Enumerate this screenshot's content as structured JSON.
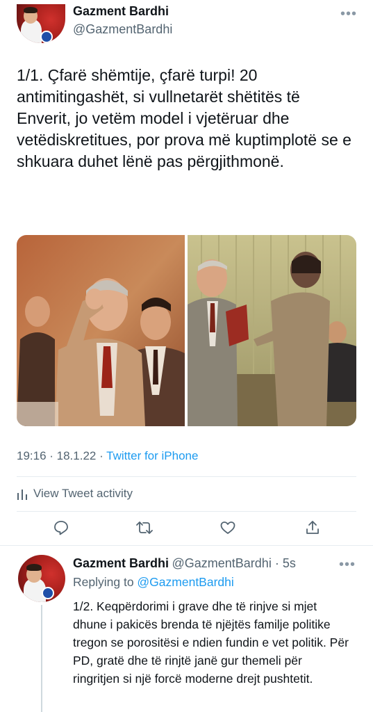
{
  "main_tweet": {
    "author_name": "Gazment Bardhi",
    "author_handle": "@GazmentBardhi",
    "more_icon": "more-horizontal-icon",
    "text": "1/1. Çfarë shëmtije, çfarë turpi! 20 antimitingashët, si vullnetarët shëtitës të Enverit, jo vetëm model i vjetëruar dhe vetëdiskretitues, por prova më kuptimplotë se e shkuara duhet lënë pas përgjithmonë.",
    "photos": [
      "photo-left",
      "photo-right"
    ],
    "time": "19:16 · 18.1.22 · ",
    "source": "Twitter for iPhone",
    "activity_label": "View Tweet activity",
    "activity_icon": "bar-chart-icon",
    "actions": [
      "reply-icon",
      "retweet-icon",
      "like-icon",
      "share-icon"
    ]
  },
  "reply_tweet": {
    "author_name": "Gazment Bardhi",
    "author_handle": "@GazmentBardhi · 5s",
    "replying_prefix": "Replying to ",
    "replying_handle": "@GazmentBardhi",
    "text": "1/2. Keqpërdorimi i grave dhe të rinjve si mjet dhune i pakicës brenda të njëjtës familje politike tregon se porositësi e ndien fundin e vet politik. Për PD, gratë dhe të rinjtë janë gur themeli për ringritjen si një forcë moderne drejt pushtetit."
  },
  "colors": {
    "accent": "#1d9bf0",
    "secondary_text": "#536471",
    "divider": "#e6ecf0"
  }
}
